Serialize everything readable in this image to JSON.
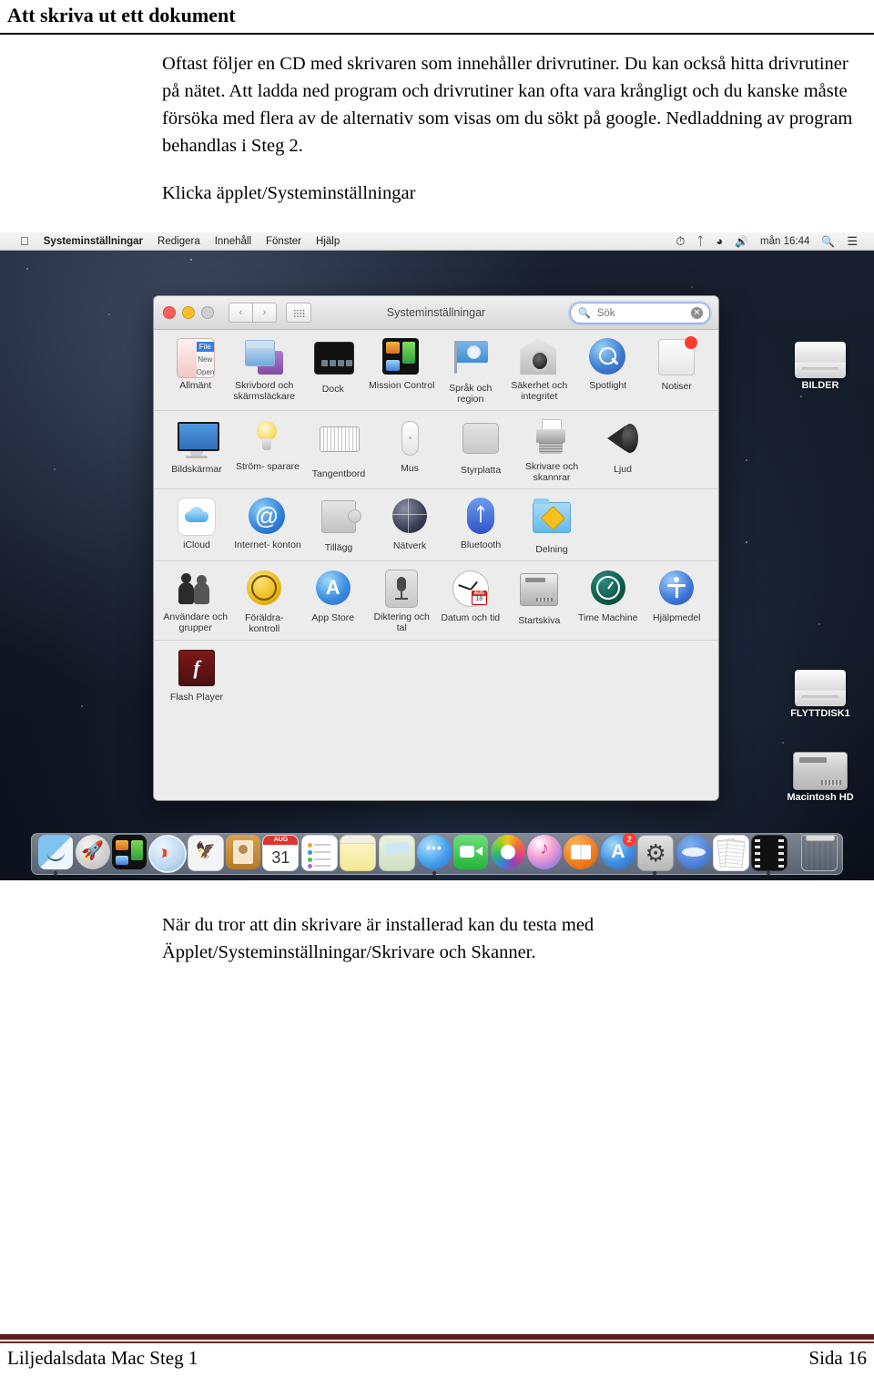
{
  "document": {
    "title": "Att skriva ut ett dokument",
    "paragraph": "Oftast följer en CD med skrivaren som innehåller drivrutiner. Du kan också hitta drivrutiner på nätet. Att ladda ned program och drivrutiner kan ofta vara krångligt och du kanske måste försöka med flera av de alternativ som visas om du sökt på google. Nedladdning av program behandlas i Steg 2.",
    "instruction": "Klicka äpplet/Systeminställningar",
    "closing": "När du tror att din skrivare är installerad kan du testa med Äpplet/Systeminställningar/Skrivare och Skanner."
  },
  "footer": {
    "left": "Liljedalsdata Mac Steg 1",
    "right": "Sida 16",
    "rule_color": "#5e1c1c"
  },
  "screenshot": {
    "menubar": {
      "apple_icon": "apple-icon",
      "items": [
        "Systeminställningar",
        "Redigera",
        "Innehåll",
        "Fönster",
        "Hjälp"
      ],
      "status_icons": [
        "time-machine-icon",
        "bluetooth-icon",
        "wifi-icon",
        "volume-icon"
      ],
      "clock": "mån 16:44",
      "right_icons": [
        "spotlight-search-icon",
        "notification-center-icon"
      ]
    },
    "desktop_icons": [
      {
        "label": "BILDER",
        "type": "external-drive"
      },
      {
        "label": "FLYTTDISK1",
        "type": "external-drive"
      },
      {
        "label": "Macintosh HD",
        "type": "hard-drive"
      }
    ],
    "prefs_window": {
      "title": "Systeminställningar",
      "search_placeholder": "Sök",
      "search_value": "",
      "nav_back": "‹",
      "nav_forward": "›",
      "grid_button": "show-all-icon",
      "rows": [
        [
          {
            "label": "Allmänt",
            "icon": "general-icon"
          },
          {
            "label": "Skrivbord och skärmsläckare",
            "icon": "desktop-screensaver-icon"
          },
          {
            "label": "Dock",
            "icon": "dock-icon"
          },
          {
            "label": "Mission Control",
            "icon": "mission-control-icon"
          },
          {
            "label": "Språk och region",
            "icon": "language-region-icon"
          },
          {
            "label": "Säkerhet och integritet",
            "icon": "security-privacy-icon"
          },
          {
            "label": "Spotlight",
            "icon": "spotlight-icon"
          },
          {
            "label": "Notiser",
            "icon": "notifications-icon"
          }
        ],
        [
          {
            "label": "Bildskärmar",
            "icon": "displays-icon"
          },
          {
            "label": "Ström- sparare",
            "icon": "energy-saver-icon"
          },
          {
            "label": "Tangentbord",
            "icon": "keyboard-icon"
          },
          {
            "label": "Mus",
            "icon": "mouse-icon"
          },
          {
            "label": "Styrplatta",
            "icon": "trackpad-icon"
          },
          {
            "label": "Skrivare och skannrar",
            "icon": "printers-scanners-icon"
          },
          {
            "label": "Ljud",
            "icon": "sound-icon"
          }
        ],
        [
          {
            "label": "iCloud",
            "icon": "icloud-icon"
          },
          {
            "label": "Internet- konton",
            "icon": "internet-accounts-icon"
          },
          {
            "label": "Tillägg",
            "icon": "extensions-icon"
          },
          {
            "label": "Nätverk",
            "icon": "network-icon"
          },
          {
            "label": "Bluetooth",
            "icon": "bluetooth-icon"
          },
          {
            "label": "Delning",
            "icon": "sharing-icon"
          }
        ],
        [
          {
            "label": "Användare och grupper",
            "icon": "users-groups-icon"
          },
          {
            "label": "Föräldra- kontroll",
            "icon": "parental-controls-icon"
          },
          {
            "label": "App Store",
            "icon": "app-store-icon"
          },
          {
            "label": "Diktering och tal",
            "icon": "dictation-speech-icon"
          },
          {
            "label": "Datum och tid",
            "icon": "date-time-icon"
          },
          {
            "label": "Startskiva",
            "icon": "startup-disk-icon"
          },
          {
            "label": "Time Machine",
            "icon": "time-machine-icon"
          },
          {
            "label": "Hjälpmedel",
            "icon": "accessibility-icon"
          }
        ],
        [
          {
            "label": "Flash Player",
            "icon": "flash-player-icon"
          }
        ]
      ]
    },
    "dock": {
      "calendar_month": "AUG",
      "calendar_day": "31",
      "app_store_badge": "2",
      "items": [
        {
          "name": "Finder"
        },
        {
          "name": "Launchpad"
        },
        {
          "name": "Mission Control"
        },
        {
          "name": "Safari"
        },
        {
          "name": "Mail"
        },
        {
          "name": "Kontakter"
        },
        {
          "name": "Kalender"
        },
        {
          "name": "Påminnelser"
        },
        {
          "name": "Anteckningar"
        },
        {
          "name": "Kartor"
        },
        {
          "name": "Meddelanden"
        },
        {
          "name": "FaceTime"
        },
        {
          "name": "Bilder"
        },
        {
          "name": "iTunes"
        },
        {
          "name": "iBooks"
        },
        {
          "name": "App Store"
        },
        {
          "name": "Systeminställningar"
        },
        {
          "name": "OpenOffice"
        },
        {
          "name": "Dokument"
        },
        {
          "name": "iMovie"
        },
        {
          "name": "Papperskorg"
        }
      ]
    }
  }
}
